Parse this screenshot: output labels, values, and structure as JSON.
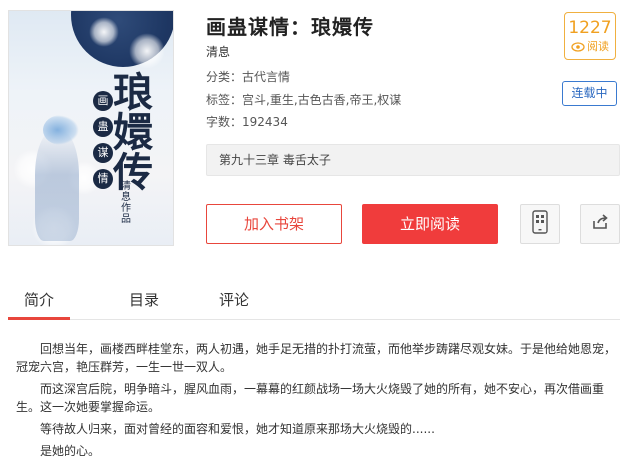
{
  "book": {
    "title": "画蛊谋情：琅嬛传",
    "author": "清息",
    "category_label": "分类：",
    "category": "古代言情",
    "tags_label": "标签：",
    "tags": "宫斗,重生,古色古香,帝王,权谋",
    "word_count_label": "字数：",
    "word_count": "192434",
    "status": "连载中",
    "latest_chapter": "第九十三章 毒舌太子"
  },
  "cover": {
    "title_chars": [
      "琅",
      "嬛",
      "传"
    ],
    "seal_chars": [
      "画",
      "蛊",
      "谋",
      "情"
    ],
    "author_text": "清息作品"
  },
  "reads": {
    "count": "1227",
    "label": "阅读",
    "icon": "eye-icon",
    "color": "#f0a020"
  },
  "actions": {
    "add_shelf": "加入书架",
    "read_now": "立即阅读",
    "mobile_icon": "mobile-qr-icon",
    "share_icon": "share-icon"
  },
  "tabs": [
    {
      "label": "简介",
      "active": true
    },
    {
      "label": "目录",
      "active": false
    },
    {
      "label": "评论",
      "active": false
    }
  ],
  "synopsis": [
    "回想当年，画楼西畔桂堂东，两人初遇，她手足无措的扑打流萤，而他举步踌躇尽观女妹。于是他给她恩宠，冠宠六宫，艳压群芳，一生一世一双人。",
    "而这深宫后院，明争暗斗，腥风血雨，一幕幕的红颜战场一场大火烧毁了她的所有，她不安心，再次借画重生。这一次她要掌握命运。",
    "等待故人归来，面对曾经的面容和爱恨，她才知道原来那场大火烧毁的......",
    "是她的心。"
  ],
  "colors": {
    "accent_red": "#f03c3c",
    "status_blue": "#2a68c0"
  }
}
